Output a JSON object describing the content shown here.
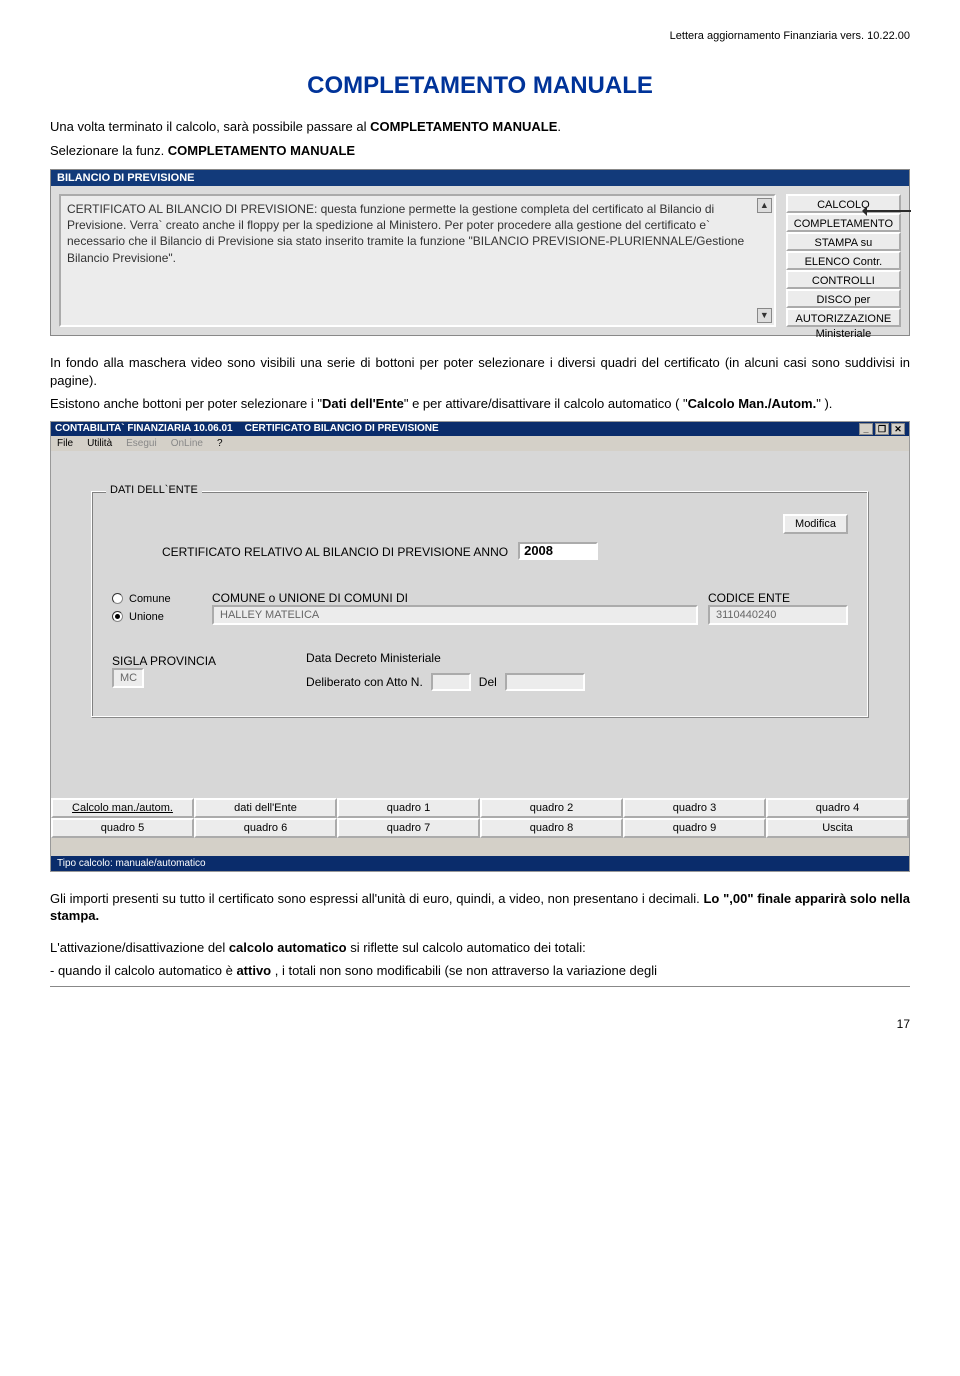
{
  "header": "Lettera aggiornamento Finanziaria vers. 10.22.00",
  "title": "COMPLETAMENTO MANUALE",
  "intro": {
    "l1a": "Una volta terminato il calcolo, sarà possibile passare al ",
    "l1b": "COMPLETAMENTO MANUALE",
    "l1c": ".",
    "l2a": "Selezionare la funz. ",
    "l2b": "COMPLETAMENTO MANUALE"
  },
  "shot1": {
    "bar": "BILANCIO DI PREVISIONE",
    "text": "CERTIFICATO AL BILANCIO DI PREVISIONE: questa funzione permette la gestione completa del certificato al Bilancio di Previsione. Verra` creato anche il floppy per la spedizione al Ministero. Per poter procedere alla gestione del certificato e` necessario che il Bilancio di Previsione sia stato inserito tramite la funzione \"BILANCIO PREVISIONE-PLURIENNALE/Gestione Bilancio Previsione\".",
    "buttons": [
      "CALCOLO Automatico",
      "COMPLETAMENTO",
      "STAMPA su Modello",
      "ELENCO Contr. Ministeriali",
      "CONTROLLI Ministeriali",
      "DISCO per Ministero",
      "AUTORIZZAZIONE Ministeriale"
    ]
  },
  "mid": {
    "p1": "In fondo alla maschera video sono visibili una serie di bottoni per poter selezionare i diversi quadri del certificato (in alcuni casi sono suddivisi in pagine).",
    "p2a": "Esistono anche bottoni per poter selezionare i \"",
    "p2b": "Dati dell'Ente",
    "p2c": "\" e per attivare/disattivare il calcolo automatico ( \"",
    "p2d": "Calcolo Man./Autom.",
    "p2e": "\" )."
  },
  "shot2": {
    "apptitle": "CONTABILITA` FINANZIARIA  10.06.01",
    "subtitle": "CERTIFICATO BILANCIO DI PREVISIONE",
    "menu": {
      "file": "File",
      "util": "Utilità",
      "esegui": "Esegui",
      "online": "OnLine",
      "q": "?"
    },
    "group_title": "DATI DELL`ENTE",
    "modifica": "Modifica",
    "cert_label": "CERTIFICATO RELATIVO AL BILANCIO DI PREVISIONE ANNO",
    "year": "2008",
    "comune": "Comune",
    "unione": "Unione",
    "comune_lbl": "COMUNE o UNIONE DI COMUNI DI",
    "comune_val": "HALLEY MATELICA",
    "codice_lbl": "CODICE ENTE",
    "codice_val": "3110440240",
    "sigla_lbl": "SIGLA PROVINCIA",
    "sigla_val": "MC",
    "data_lbl": "Data Decreto Ministeriale",
    "delib_lbl": "Deliberato con Atto N.",
    "del_lbl": "Del",
    "row1": [
      "Calcolo man./autom.",
      "dati dell'Ente",
      "quadro 1",
      "quadro 2",
      "quadro 3",
      "quadro 4"
    ],
    "row2": [
      "quadro 5",
      "quadro 6",
      "quadro 7",
      "quadro 8",
      "quadro 9",
      "Uscita"
    ],
    "status": "Tipo calcolo: manuale/automatico"
  },
  "foot": {
    "p1a": "Gli importi presenti su tutto il certificato sono espressi all'unità di euro, quindi, a video, non presentano i decimali. ",
    "p1b": "Lo  \",00\"  finale  apparirà  solo  nella stampa.",
    "p2a": "L'attivazione/disattivazione del ",
    "p2b": "calcolo automatico",
    "p2c": " si riflette sul calcolo automatico dei totali:",
    "li1": "-   quando il calcolo automatico è ",
    "li1b": "attivo",
    "li1c": " , i totali non sono modificabili (se non attraverso la variazione degli"
  },
  "pagenum": "17"
}
